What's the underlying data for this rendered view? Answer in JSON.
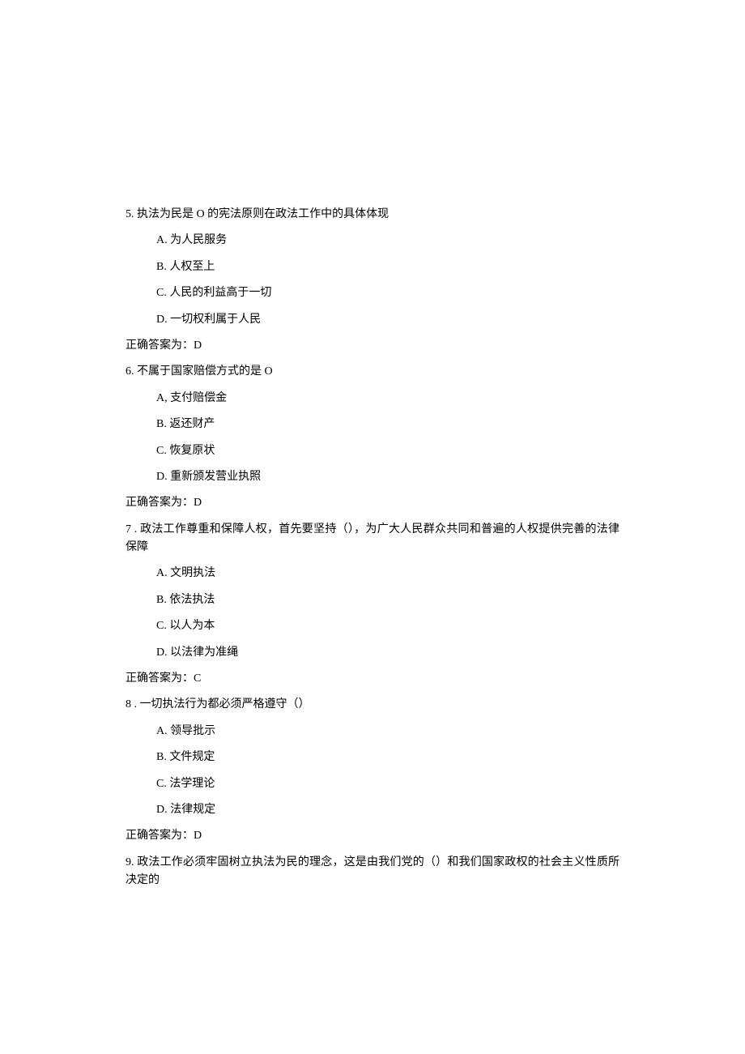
{
  "questions": [
    {
      "number": "5.",
      "stem": "执法为民是 O 的宪法原则在政法工作中的具体体现",
      "options": [
        "A. 为人民服务",
        "B. 人权至上",
        "C. 人民的利益高于一切",
        "D. 一切权利属于人民"
      ],
      "answer_label": "正确答案为：",
      "answer": "D"
    },
    {
      "number": "6.",
      "stem": "不属于国家赔偿方式的是 O",
      "options": [
        "A, 支付赔偿金",
        "B. 返还财产",
        "C. 恢复原状",
        "D. 重新颁发营业执照"
      ],
      "answer_label": "正确答案为：",
      "answer": "D"
    },
    {
      "number": "7 .",
      "stem": "政法工作尊重和保障人权，首先要坚持（），为广大人民群众共同和普遍的人权提供完善的法律保障",
      "options": [
        "A. 文明执法",
        "B. 依法执法",
        "C. 以人为本",
        "D. 以法律为准绳"
      ],
      "answer_label": "正确答案为：",
      "answer": "C"
    },
    {
      "number": "8 .",
      "stem": "一切执法行为都必须严格遵守（）",
      "options": [
        "A. 领导批示",
        "B. 文件规定",
        "C. 法学理论",
        "D. 法律规定"
      ],
      "answer_label": "正确答案为：",
      "answer": "D"
    },
    {
      "number": "9.",
      "stem": "政法工作必须牢固树立执法为民的理念，这是由我们党的（）和我们国家政权的社会主义性质所决定的",
      "options": [],
      "answer_label": "",
      "answer": ""
    }
  ]
}
